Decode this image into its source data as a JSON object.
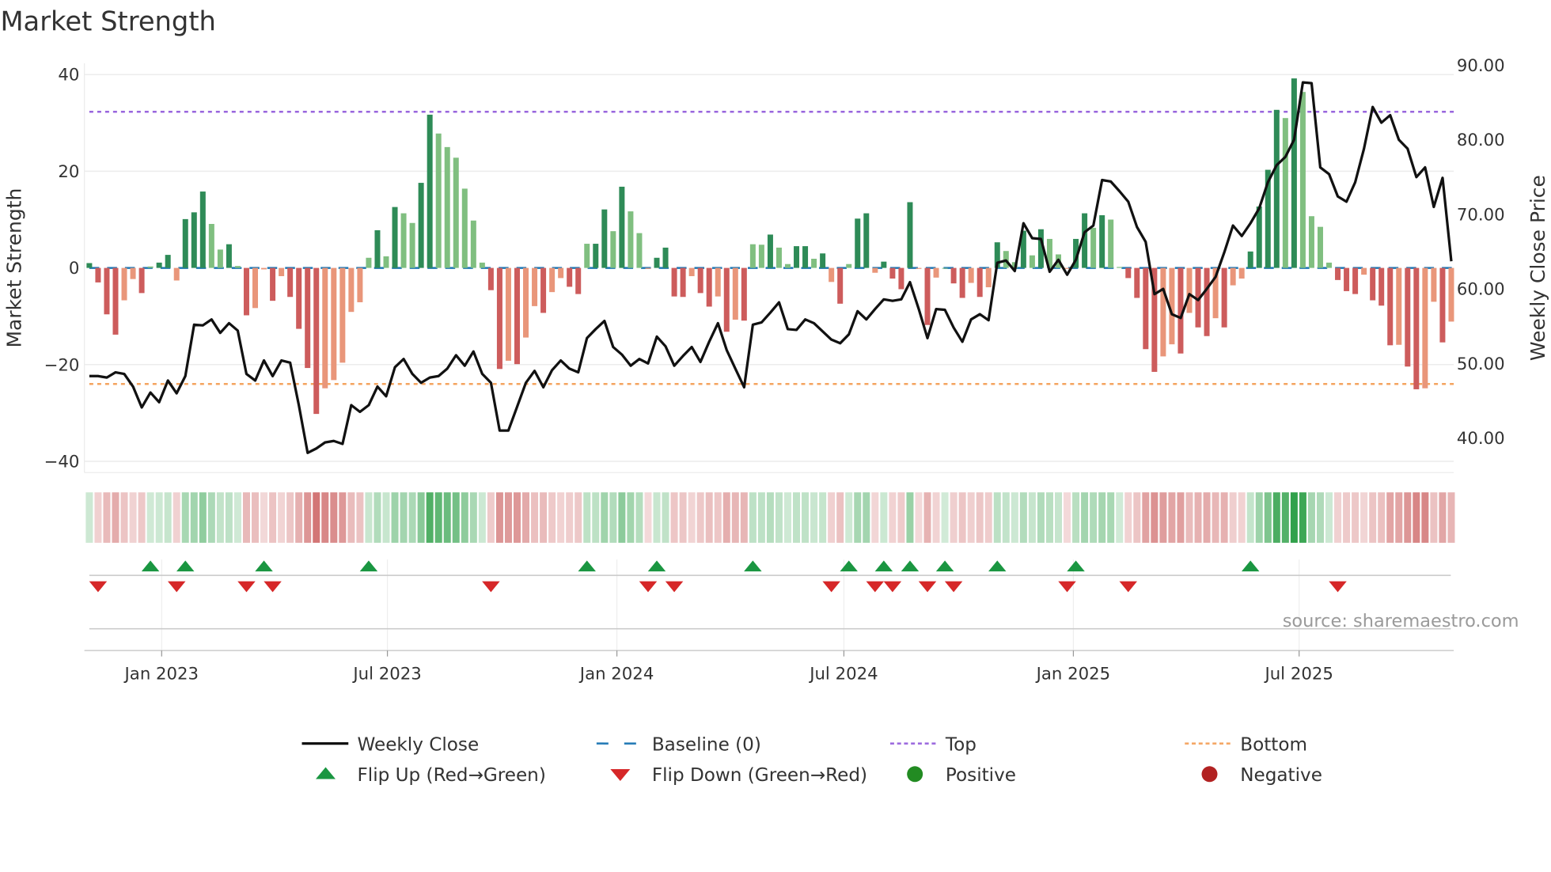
{
  "chart_data": {
    "type": "bar",
    "title": "Market Strength",
    "ylabel": "Market Strength",
    "y2label": "Weekly Close Price",
    "ylim": [
      -42,
      42
    ],
    "y2lim": [
      37.3,
      91.3
    ],
    "y_ticks": [
      "40",
      "20",
      "0",
      "−20",
      "−40"
    ],
    "y_tick_values": [
      40,
      20,
      0,
      -20,
      -40
    ],
    "y2_ticks": [
      "90.00",
      "80.00",
      "70.00",
      "60.00",
      "50.00",
      "40.00"
    ],
    "y2_tick_values": [
      90,
      80,
      70,
      60,
      50,
      40
    ],
    "x_ticks": [
      {
        "label": "Jan 2023",
        "date": "2023-01-01"
      },
      {
        "label": "Jul 2023",
        "date": "2023-07-01"
      },
      {
        "label": "Jan 2024",
        "date": "2024-01-01"
      },
      {
        "label": "Jul 2024",
        "date": "2024-07-01"
      },
      {
        "label": "Jan 2025",
        "date": "2025-01-01"
      },
      {
        "label": "Jul 2025",
        "date": "2025-07-01"
      }
    ],
    "start_week": "2022-11-04",
    "frequency": "weekly",
    "top_level": 32.3,
    "bottom_level": -24.0,
    "baseline": 0,
    "strength": [
      1,
      -3,
      -9.6,
      -13.8,
      -6.7,
      -2.3,
      -5.2,
      0.3,
      1.1,
      2.7,
      -2.6,
      10.1,
      11.5,
      15.8,
      9.1,
      3.8,
      4.9,
      0.4,
      -9.8,
      -8.3,
      -0.3,
      -6.8,
      -1.7,
      -6,
      -12.6,
      -20.7,
      -30.2,
      -24.9,
      -23.2,
      -19.6,
      -9.1,
      -7.1,
      2.1,
      7.8,
      2.4,
      12.6,
      11.3,
      9.3,
      17.6,
      31.7,
      27.8,
      25,
      22.8,
      16.4,
      9.8,
      1.1,
      -4.6,
      -20.9,
      -19.2,
      -19.9,
      -14.4,
      -7.9,
      -9.3,
      -5,
      -2.1,
      -3.9,
      -5.4,
      5,
      5,
      12.1,
      7.6,
      16.8,
      11.7,
      7.2,
      -0.2,
      2.1,
      4.2,
      -5.9,
      -6,
      -1.7,
      -5.2,
      -8,
      -5.9,
      -13.2,
      -10.7,
      -10.9,
      4.9,
      4.8,
      6.9,
      4.2,
      0.8,
      4.5,
      4.5,
      1.9,
      3,
      -2.9,
      -7.4,
      0.8,
      10.2,
      11.3,
      -1,
      1.3,
      -2.2,
      -4.4,
      13.6,
      -0.2,
      -11.8,
      -2,
      0,
      -3.2,
      -6.2,
      -3.1,
      -6,
      -4,
      5.3,
      3.5,
      1.2,
      7.7,
      2.6,
      8,
      6,
      2.8,
      -0.2,
      6,
      11.3,
      8.3,
      10.9,
      10,
      0.2,
      -2.1,
      -6.2,
      -16.8,
      -21.5,
      -18.3,
      -15.8,
      -17.7,
      -9.3,
      -12.3,
      -14.1,
      -10.4,
      -12.3,
      -3.6,
      -2.2,
      3.4,
      12.7,
      20.3,
      32.7,
      31,
      39.2,
      36.4,
      10.7,
      8.5,
      1.1,
      -2.5,
      -4.8,
      -5.4,
      -1.4,
      -6.7,
      -7.8,
      -16,
      -15.9,
      -20.4,
      -25.1,
      -24.9,
      -7,
      -15.4,
      -11.1
    ],
    "close": [
      48.3,
      48.3,
      48.1,
      48.8,
      48.6,
      46.9,
      44.1,
      46.1,
      44.8,
      47.7,
      46,
      48.3,
      55.2,
      55.1,
      55.9,
      54.1,
      55.4,
      54.4,
      48.6,
      47.7,
      50.4,
      48.3,
      50.4,
      50.1,
      44.4,
      38,
      38.6,
      39.4,
      39.6,
      39.2,
      44.4,
      43.5,
      44.4,
      46.9,
      45.6,
      49.5,
      50.6,
      48.6,
      47.4,
      48.1,
      48.3,
      49.3,
      51.1,
      49.7,
      51.6,
      48.6,
      47.4,
      41,
      41,
      44.2,
      47.4,
      49,
      46.8,
      49.1,
      50.4,
      49.3,
      48.8,
      53.4,
      54.6,
      55.7,
      52.2,
      51.2,
      49.7,
      50.6,
      50,
      53.6,
      52.3,
      49.7,
      51,
      52.2,
      50.2,
      52.9,
      55.4,
      51.8,
      49.3,
      46.8,
      55.2,
      55.5,
      56.8,
      58.2,
      54.6,
      54.5,
      55.9,
      55.4,
      54.3,
      53.2,
      52.7,
      53.9,
      57,
      55.9,
      57.3,
      58.6,
      58.4,
      58.6,
      60.9,
      57.3,
      53.4,
      57.3,
      57.2,
      54.8,
      52.9,
      55.9,
      56.6,
      55.8,
      63.5,
      63.8,
      62.4,
      68.8,
      66.8,
      66.7,
      62.3,
      63.9,
      61.9,
      63.9,
      67.6,
      68.5,
      74.6,
      74.4,
      73.1,
      71.7,
      68.3,
      66.3,
      59.3,
      60,
      56.6,
      56.1,
      59.3,
      58.5,
      60,
      61.6,
      64.9,
      68.5,
      67.1,
      68.8,
      70.8,
      74.3,
      76.6,
      77.7,
      80,
      87.7,
      87.6,
      76.3,
      75.4,
      72.4,
      71.7,
      74.3,
      78.8,
      84.4,
      82.3,
      83.3,
      80,
      78.8,
      75,
      76.3,
      71,
      74.9,
      63.7
    ],
    "flip_up_weeks": [
      7,
      11,
      20,
      32,
      57,
      65,
      76,
      87,
      91,
      94,
      98,
      104,
      113,
      133
    ],
    "flip_down_weeks": [
      1,
      10,
      18,
      21,
      46,
      64,
      67,
      85,
      90,
      92,
      96,
      99,
      112,
      119,
      143
    ],
    "legend_placement": "bottom",
    "legend": [
      {
        "key": "close",
        "label": "Weekly Close"
      },
      {
        "key": "baseline",
        "label": "Baseline (0)"
      },
      {
        "key": "top",
        "label": "Top"
      },
      {
        "key": "bottom",
        "label": "Bottom"
      },
      {
        "key": "flip_up",
        "label": "Flip Up (Red→Green)"
      },
      {
        "key": "flip_down",
        "label": "Flip Down (Green→Red)"
      },
      {
        "key": "positive",
        "label": "Positive"
      },
      {
        "key": "negative",
        "label": "Negative"
      }
    ],
    "colors": {
      "pos_strong": "#2e8b57",
      "pos_weak": "#80bf80",
      "neg_strong": "#cd5c5c",
      "neg_weak": "#e9967a",
      "close": "#111111",
      "baseline": "#1f77b4",
      "top": "#9966dd",
      "bottom": "#f4a460",
      "flip_up": "#1a9641",
      "flip_down": "#d62728",
      "positive": "#228b22",
      "negative": "#b22222"
    },
    "grid": true
  },
  "source": "source: sharemaestro.com"
}
